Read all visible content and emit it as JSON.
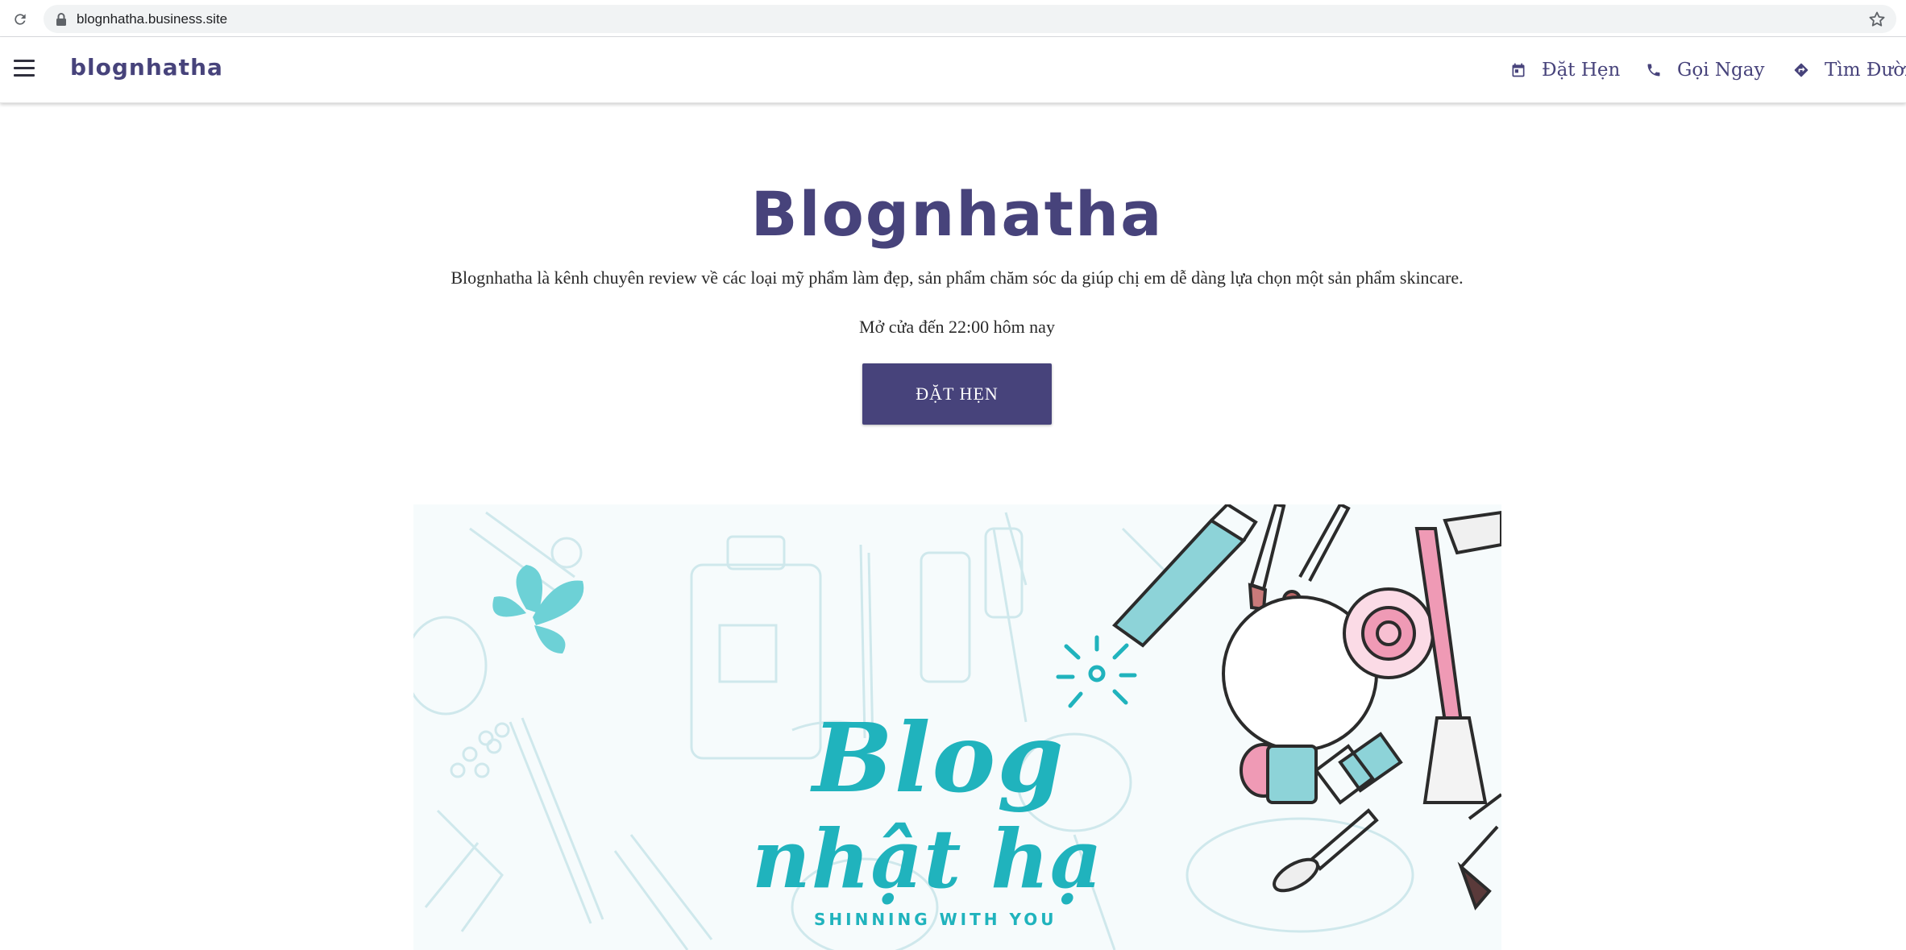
{
  "browser": {
    "url": "blognhatha.business.site"
  },
  "header": {
    "brand": "blognhatha",
    "actions": [
      {
        "label": "Đặt Hẹn",
        "icon": "calendar-icon"
      },
      {
        "label": "Gọi Ngay",
        "icon": "phone-icon"
      },
      {
        "label": "Tìm Đườn",
        "icon": "directions-icon"
      }
    ]
  },
  "hero": {
    "title": "Blognhatha",
    "description": "Blognhatha là kênh chuyên review về các loại mỹ phẩm làm đẹp, sản phẩm chăm sóc da giúp chị em dễ dàng lựa chọn một sản phẩm skincare.",
    "hours": "Mở cửa đến 22:00 hôm nay",
    "cta_label": "ĐẶT HẸN"
  },
  "cover": {
    "logo_line1": "Blog",
    "logo_line2": "nhật hạ",
    "tagline": "SHINNING WITH YOU"
  },
  "colors": {
    "brand": "#47437b",
    "accent_teal": "#20b3bd",
    "pink": "#ef9ab5"
  }
}
